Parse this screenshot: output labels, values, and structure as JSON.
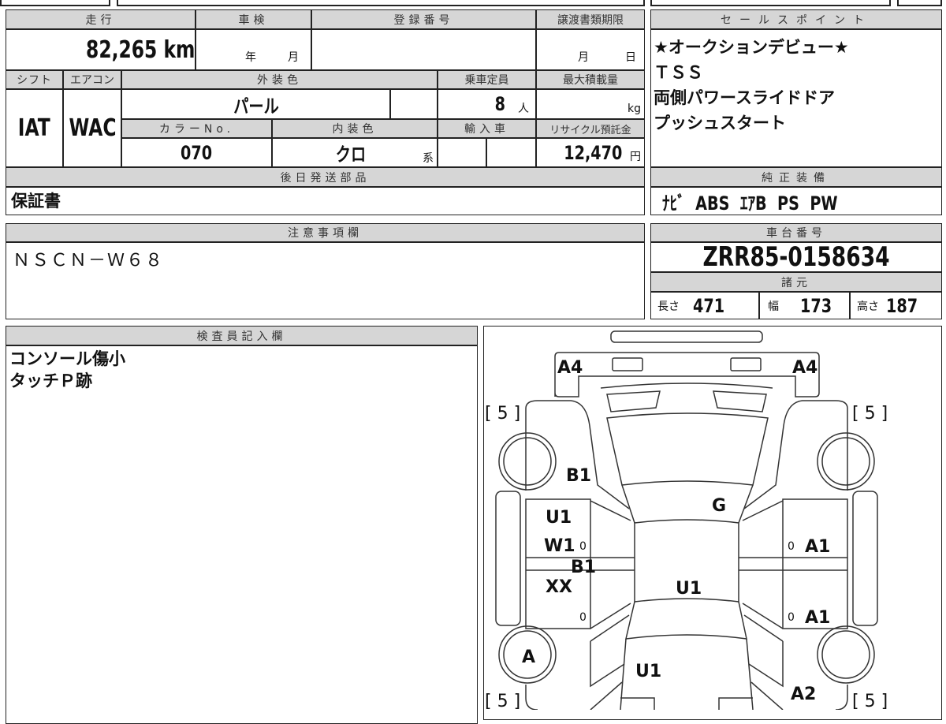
{
  "basic": {
    "mileage_label": "走行",
    "mileage": "82,265 km",
    "inspection_label": "車検",
    "inspection_year": "年",
    "inspection_month": "月",
    "registration_label": "登録番号",
    "transfer_label": "譲渡書類期限",
    "transfer_month": "月",
    "transfer_day": "日",
    "shift_label": "シフト",
    "shift": "IAT",
    "aircon_label": "エアコン",
    "aircon": "WAC",
    "exterior_label": "外装色",
    "exterior": "パール",
    "capacity_label": "乗車定員",
    "capacity": "8",
    "capacity_unit": "人",
    "max_load_label": "最大積載量",
    "max_load_unit": "kg",
    "color_no_label": "カラーNo.",
    "color_no": "070",
    "interior_label": "内装色",
    "interior": "クロ",
    "interior_suffix": "系",
    "import_label": "輸入車",
    "recycle_label": "リサイクル預託金",
    "recycle": "12,470",
    "recycle_unit": "円",
    "later_parts_label": "後日発送部品",
    "later_parts": "保証書"
  },
  "sales": {
    "label": "セールスポイント",
    "lines": [
      "★オークションデビュー★",
      "ＴＳＳ",
      "両側パワースライドドア",
      "プッシュスタート"
    ],
    "equipment_label": "純正装備",
    "equipment": "ﾅﾋﾞ  ABS  ｴｱB  PS  PW"
  },
  "notes": {
    "label": "注意事項欄",
    "text": "ＮＳＣＮ－Ｗ６８"
  },
  "chassis": {
    "label": "車台番号",
    "number": "ZRR85-0158634",
    "spec_label": "諸元",
    "length_label": "長さ",
    "length": "471",
    "width_label": "幅",
    "width": "173",
    "height_label": "高さ",
    "height": "187"
  },
  "inspector": {
    "label": "検査員記入欄",
    "lines": [
      "コンソール傷小",
      "タッチＰ跡"
    ]
  },
  "diagram": {
    "tire_front_left": "[ 5 ]",
    "tire_front_right": "[ 5 ]",
    "tire_rear_left": "[ 5 ]",
    "tire_rear_right": "[ 5 ]",
    "marks": {
      "front_bumper_left": "A4",
      "front_bumper_right": "A4",
      "left_front_fender": "B1",
      "left_front_door_1": "U1",
      "left_front_door_2": "W1",
      "left_pillar": "B1",
      "left_rear_door": "XX",
      "windshield": "G",
      "roof": "U1",
      "left_rear_wheel": "A",
      "rear_glass": "U1",
      "right_front_door": "A1",
      "right_rear_door": "A1",
      "right_rear_fender": "A2",
      "zero1": "0",
      "zero2": "0",
      "zero3": "0",
      "zero4": "0"
    }
  }
}
